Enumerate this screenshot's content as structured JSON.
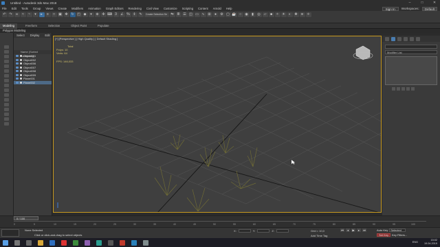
{
  "window": {
    "title": "Untitled - Autodesk 3ds Max 2018"
  },
  "menu": {
    "items": [
      "File",
      "Edit",
      "Tools",
      "Group",
      "Views",
      "Create",
      "Modifiers",
      "Animation",
      "Graph Editors",
      "Rendering",
      "Civil View",
      "Customize",
      "Scripting",
      "Content",
      "Arnold",
      "Help"
    ],
    "sign_in": "Sign In",
    "workspaces_label": "Workspaces:",
    "workspace_value": "Default"
  },
  "toolbar": {
    "selection_set": "Create Selection Se"
  },
  "ribbon": {
    "tabs": [
      "Modeling",
      "Freeform",
      "Selection",
      "Object Paint",
      "Populate"
    ],
    "active_tab": "Modeling",
    "subtitle": "Polygon Modeling"
  },
  "scene_explorer": {
    "tabs": [
      "Select",
      "Display",
      "Edit"
    ],
    "header": "Name (Sorted Ascending)",
    "rows": [
      "Object001",
      "Object002",
      "Object006",
      "Object007",
      "Object008",
      "Object009",
      "Plane001",
      "Plane002"
    ]
  },
  "viewport": {
    "label": "[+] [Perspective ] [ High Quality ] [ Default Shading ]",
    "stats": {
      "total_label": "Total",
      "polys_label": "Polys:",
      "polys": "10",
      "verts_label": "Verts:",
      "verts": "64"
    },
    "fps_label": "FPS:",
    "fps": "146,033"
  },
  "command_panel": {
    "modifier_list": "Modifier List"
  },
  "timeline": {
    "slider": "0 / 100",
    "ticks": [
      "0",
      "5",
      "10",
      "15",
      "20",
      "25",
      "30",
      "35",
      "40",
      "45",
      "50",
      "55",
      "60",
      "65",
      "70",
      "75",
      "80",
      "85",
      "90",
      "95",
      "100"
    ]
  },
  "status": {
    "selection": "None Selected",
    "prompt": "Click or click-and-drag to select objects",
    "x_label": "X:",
    "y_label": "Y:",
    "z_label": "Z:",
    "grid": "Grid = 10,0",
    "add_time_tag": "Add Time Tag",
    "auto_key": "Auto Key",
    "selected": "Selected",
    "set_key": "Set Key",
    "key_filters": "Key Filters..."
  },
  "taskbar": {
    "lang": "ENG",
    "time": "15:02",
    "date": "19.04.2019"
  },
  "colors": {
    "viewport_border": "#c89a1e",
    "selection_blue": "#4d6a87",
    "background": "#2b2b2b"
  }
}
